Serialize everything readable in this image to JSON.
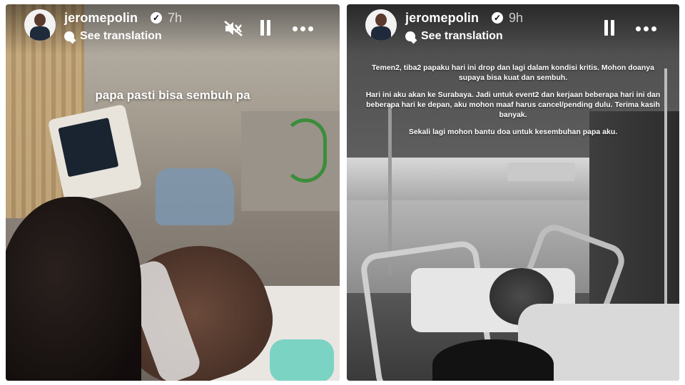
{
  "stories": [
    {
      "username": "jeromepolin",
      "time": "7h",
      "translate_label": "See translation",
      "caption": "papa pasti bisa sembuh pa",
      "controls": [
        "muted-speaker-icon",
        "pause-icon",
        "more-icon"
      ]
    },
    {
      "username": "jeromepolin",
      "time": "9h",
      "translate_label": "See translation",
      "caption_paragraphs": [
        "Temen2, tiba2 papaku hari ini drop dan lagi dalam kondisi kritis. Mohon doanya supaya bisa kuat dan sembuh.",
        "Hari ini aku akan ke Surabaya. Jadi untuk event2 dan kerjaan beberapa hari ini dan beberapa hari ke depan, aku mohon maaf harus cancel/pending dulu. Terima kasih banyak.",
        "Sekali lagi mohon bantu doa untuk kesembuhan papa aku."
      ],
      "controls": [
        "pause-icon",
        "more-icon"
      ]
    }
  ]
}
